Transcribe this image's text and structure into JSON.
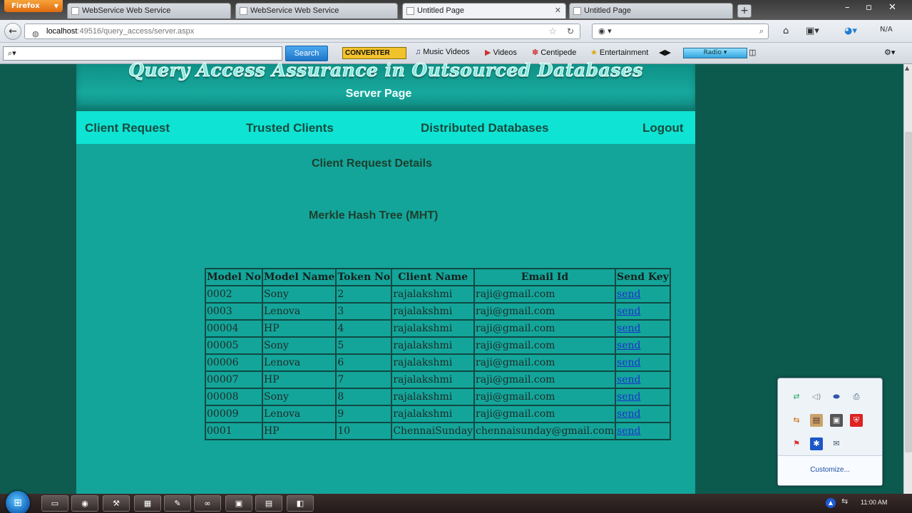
{
  "browser": {
    "firefox_label": "Firefox",
    "tabs": [
      {
        "title": "WebService Web Service",
        "active": false
      },
      {
        "title": "WebService Web Service",
        "active": false
      },
      {
        "title": "Untitled Page",
        "active": true
      },
      {
        "title": "Untitled Page",
        "active": false
      }
    ],
    "url_host": "localhost",
    "url_rest": ":49516/query_access/server.aspx",
    "zoom_text": "N/A",
    "toolbar": {
      "search_placeholder": "",
      "search_button": "Search",
      "converter": "CONVERTER",
      "links": [
        "Music Videos",
        "Videos",
        "Centipede",
        "Entertainment"
      ],
      "radio": "Radio"
    }
  },
  "page": {
    "site_title": "Query Access Assurance in Outsourced Databases",
    "subtitle": "Server Page",
    "menu": [
      "Client Request",
      "Trusted Clients",
      "Distributed Databases",
      "Logout"
    ],
    "section_title": "Client Request Details",
    "mht_label": "Merkle Hash Tree (MHT)",
    "table": {
      "headers": [
        "Model No",
        "Model Name",
        "Token No",
        "Client Name",
        "Email Id",
        "Send Key"
      ],
      "rows": [
        [
          "0002",
          "Sony",
          "2",
          "rajalakshmi",
          "raji@gmail.com",
          "send"
        ],
        [
          "0003",
          "Lenova",
          "3",
          "rajalakshmi",
          "raji@gmail.com",
          "send"
        ],
        [
          "00004",
          "HP",
          "4",
          "rajalakshmi",
          "raji@gmail.com",
          "send"
        ],
        [
          "00005",
          "Sony",
          "5",
          "rajalakshmi",
          "raji@gmail.com",
          "send"
        ],
        [
          "00006",
          "Lenova",
          "6",
          "rajalakshmi",
          "raji@gmail.com",
          "send"
        ],
        [
          "00007",
          "HP",
          "7",
          "rajalakshmi",
          "raji@gmail.com",
          "send"
        ],
        [
          "00008",
          "Sony",
          "8",
          "rajalakshmi",
          "raji@gmail.com",
          "send"
        ],
        [
          "00009",
          "Lenova",
          "9",
          "rajalakshmi",
          "raji@gmail.com",
          "send"
        ],
        [
          "0001",
          "HP",
          "10",
          "ChennaiSunday",
          "chennaisunday@gmail.com",
          "send"
        ]
      ]
    }
  },
  "tray_flyout": {
    "customize": "Customize..."
  },
  "taskbar": {
    "clock": "11:00 AM"
  },
  "colors": {
    "background": "#0c5a4e",
    "container": "#14a59a",
    "menu_bar": "#0fe3d3",
    "menu_text": "#154b3f",
    "link": "#1b33c8"
  }
}
